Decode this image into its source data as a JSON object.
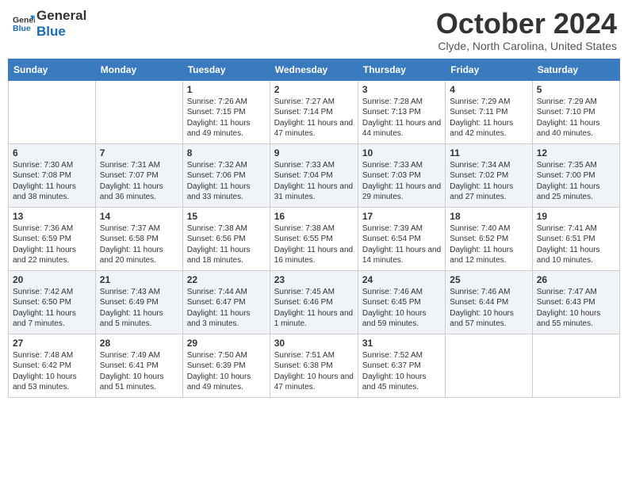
{
  "header": {
    "logo_general": "General",
    "logo_blue": "Blue",
    "month": "October 2024",
    "location": "Clyde, North Carolina, United States"
  },
  "weekdays": [
    "Sunday",
    "Monday",
    "Tuesday",
    "Wednesday",
    "Thursday",
    "Friday",
    "Saturday"
  ],
  "weeks": [
    [
      {
        "day": "",
        "detail": ""
      },
      {
        "day": "",
        "detail": ""
      },
      {
        "day": "1",
        "detail": "Sunrise: 7:26 AM\nSunset: 7:15 PM\nDaylight: 11 hours and 49 minutes."
      },
      {
        "day": "2",
        "detail": "Sunrise: 7:27 AM\nSunset: 7:14 PM\nDaylight: 11 hours and 47 minutes."
      },
      {
        "day": "3",
        "detail": "Sunrise: 7:28 AM\nSunset: 7:13 PM\nDaylight: 11 hours and 44 minutes."
      },
      {
        "day": "4",
        "detail": "Sunrise: 7:29 AM\nSunset: 7:11 PM\nDaylight: 11 hours and 42 minutes."
      },
      {
        "day": "5",
        "detail": "Sunrise: 7:29 AM\nSunset: 7:10 PM\nDaylight: 11 hours and 40 minutes."
      }
    ],
    [
      {
        "day": "6",
        "detail": "Sunrise: 7:30 AM\nSunset: 7:08 PM\nDaylight: 11 hours and 38 minutes."
      },
      {
        "day": "7",
        "detail": "Sunrise: 7:31 AM\nSunset: 7:07 PM\nDaylight: 11 hours and 36 minutes."
      },
      {
        "day": "8",
        "detail": "Sunrise: 7:32 AM\nSunset: 7:06 PM\nDaylight: 11 hours and 33 minutes."
      },
      {
        "day": "9",
        "detail": "Sunrise: 7:33 AM\nSunset: 7:04 PM\nDaylight: 11 hours and 31 minutes."
      },
      {
        "day": "10",
        "detail": "Sunrise: 7:33 AM\nSunset: 7:03 PM\nDaylight: 11 hours and 29 minutes."
      },
      {
        "day": "11",
        "detail": "Sunrise: 7:34 AM\nSunset: 7:02 PM\nDaylight: 11 hours and 27 minutes."
      },
      {
        "day": "12",
        "detail": "Sunrise: 7:35 AM\nSunset: 7:00 PM\nDaylight: 11 hours and 25 minutes."
      }
    ],
    [
      {
        "day": "13",
        "detail": "Sunrise: 7:36 AM\nSunset: 6:59 PM\nDaylight: 11 hours and 22 minutes."
      },
      {
        "day": "14",
        "detail": "Sunrise: 7:37 AM\nSunset: 6:58 PM\nDaylight: 11 hours and 20 minutes."
      },
      {
        "day": "15",
        "detail": "Sunrise: 7:38 AM\nSunset: 6:56 PM\nDaylight: 11 hours and 18 minutes."
      },
      {
        "day": "16",
        "detail": "Sunrise: 7:38 AM\nSunset: 6:55 PM\nDaylight: 11 hours and 16 minutes."
      },
      {
        "day": "17",
        "detail": "Sunrise: 7:39 AM\nSunset: 6:54 PM\nDaylight: 11 hours and 14 minutes."
      },
      {
        "day": "18",
        "detail": "Sunrise: 7:40 AM\nSunset: 6:52 PM\nDaylight: 11 hours and 12 minutes."
      },
      {
        "day": "19",
        "detail": "Sunrise: 7:41 AM\nSunset: 6:51 PM\nDaylight: 11 hours and 10 minutes."
      }
    ],
    [
      {
        "day": "20",
        "detail": "Sunrise: 7:42 AM\nSunset: 6:50 PM\nDaylight: 11 hours and 7 minutes."
      },
      {
        "day": "21",
        "detail": "Sunrise: 7:43 AM\nSunset: 6:49 PM\nDaylight: 11 hours and 5 minutes."
      },
      {
        "day": "22",
        "detail": "Sunrise: 7:44 AM\nSunset: 6:47 PM\nDaylight: 11 hours and 3 minutes."
      },
      {
        "day": "23",
        "detail": "Sunrise: 7:45 AM\nSunset: 6:46 PM\nDaylight: 11 hours and 1 minute."
      },
      {
        "day": "24",
        "detail": "Sunrise: 7:46 AM\nSunset: 6:45 PM\nDaylight: 10 hours and 59 minutes."
      },
      {
        "day": "25",
        "detail": "Sunrise: 7:46 AM\nSunset: 6:44 PM\nDaylight: 10 hours and 57 minutes."
      },
      {
        "day": "26",
        "detail": "Sunrise: 7:47 AM\nSunset: 6:43 PM\nDaylight: 10 hours and 55 minutes."
      }
    ],
    [
      {
        "day": "27",
        "detail": "Sunrise: 7:48 AM\nSunset: 6:42 PM\nDaylight: 10 hours and 53 minutes."
      },
      {
        "day": "28",
        "detail": "Sunrise: 7:49 AM\nSunset: 6:41 PM\nDaylight: 10 hours and 51 minutes."
      },
      {
        "day": "29",
        "detail": "Sunrise: 7:50 AM\nSunset: 6:39 PM\nDaylight: 10 hours and 49 minutes."
      },
      {
        "day": "30",
        "detail": "Sunrise: 7:51 AM\nSunset: 6:38 PM\nDaylight: 10 hours and 47 minutes."
      },
      {
        "day": "31",
        "detail": "Sunrise: 7:52 AM\nSunset: 6:37 PM\nDaylight: 10 hours and 45 minutes."
      },
      {
        "day": "",
        "detail": ""
      },
      {
        "day": "",
        "detail": ""
      }
    ]
  ]
}
